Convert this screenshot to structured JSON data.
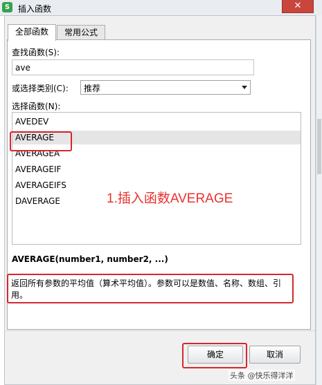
{
  "window": {
    "title": "插入函数",
    "app_icon_glyph": "S",
    "close_glyph": "✕"
  },
  "tabs": [
    {
      "label": "全部函数",
      "active": true
    },
    {
      "label": "常用公式",
      "active": false
    }
  ],
  "search": {
    "label": "查找函数(S):",
    "value": "ave"
  },
  "category": {
    "label": "或选择类别(C):",
    "selected": "推荐"
  },
  "function_list": {
    "label": "选择函数(N):",
    "items": [
      "AVEDEV",
      "AVERAGE",
      "AVERAGEA",
      "AVERAGEIF",
      "AVERAGEIFS",
      "DAVERAGE"
    ],
    "selected": "AVERAGE"
  },
  "annotation": "1.插入函数AVERAGE",
  "signature": "AVERAGE(number1, number2, ...)",
  "description": "返回所有参数的平均值（算术平均值）。参数可以是数值、名称、数组、引用。",
  "buttons": {
    "ok": "确定",
    "cancel": "取消"
  },
  "watermark": "头条 @快乐得洋洋",
  "colors": {
    "highlight": "#d7262b",
    "annotation": "#e8322f",
    "app_icon": "#37a04c"
  }
}
